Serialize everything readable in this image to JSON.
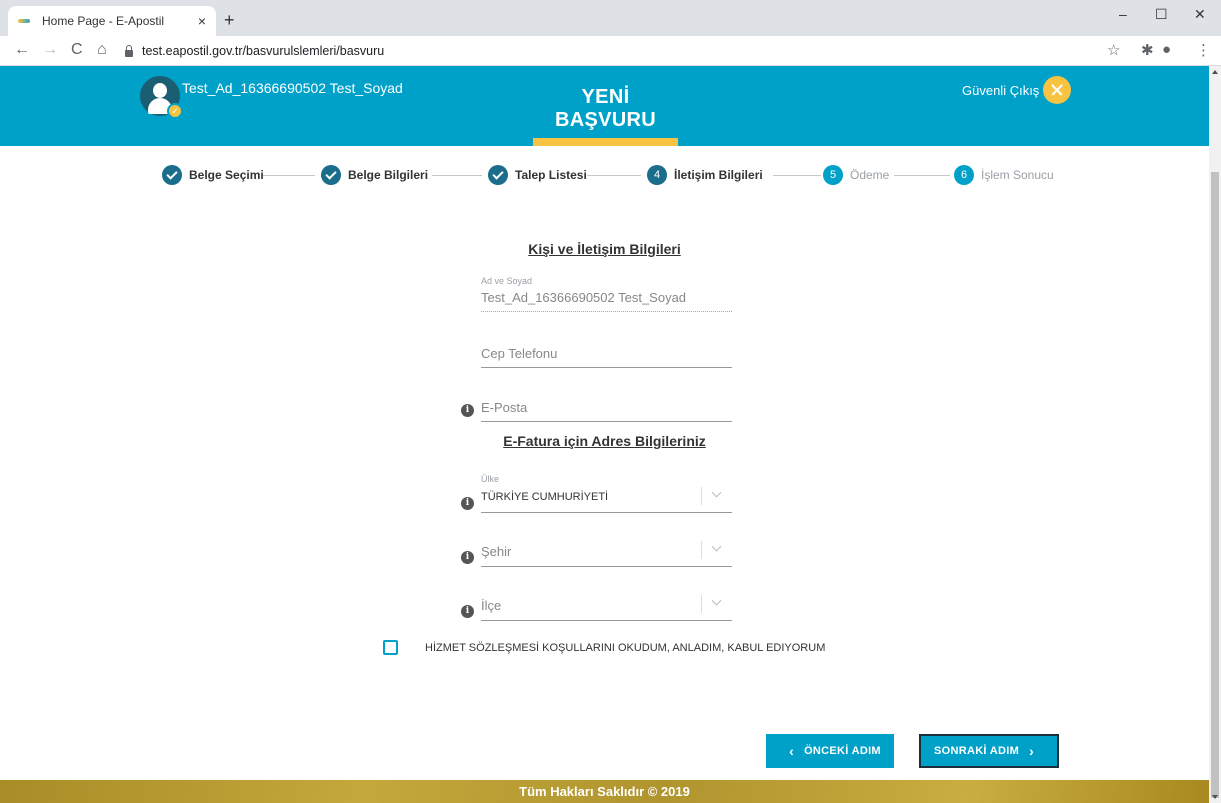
{
  "browser": {
    "tab_title": "Home Page - E-Apostil",
    "tab_close": "×",
    "new_tab": "+",
    "url": "test.eapostil.gov.tr/basvurulslemleri/basvuru",
    "window_controls": [
      "–",
      "☐",
      "✕"
    ]
  },
  "header": {
    "user_name": "Test_Ad_16366690502 Test_Soyad",
    "page_title": "YENİ BAŞVURU",
    "logout_label": "Güvenli Çıkış",
    "accent_color": "#00a1c9",
    "highlight_color": "#f6c342"
  },
  "steps": [
    {
      "number": "1",
      "label": "Belge Seçimi",
      "status": "done"
    },
    {
      "number": "2",
      "label": "Belge Bilgileri",
      "status": "done"
    },
    {
      "number": "3",
      "label": "Talep Listesi",
      "status": "done"
    },
    {
      "number": "4",
      "label": "İletişim Bilgileri",
      "status": "active"
    },
    {
      "number": "5",
      "label": "Ödeme",
      "status": "pending"
    },
    {
      "number": "6",
      "label": "İşlem Sonucu",
      "status": "pending"
    }
  ],
  "contact": {
    "section_title": "Kişi ve İletişim Bilgileri",
    "name_label": "Ad ve Soyad",
    "name_value": "Test_Ad_16366690502 Test_Soyad",
    "phone_placeholder": "Cep Telefonu",
    "email_placeholder": "E-Posta"
  },
  "address": {
    "section_title": "E-Fatura için Adres Bilgileriniz",
    "country_label": "Ülke",
    "country_value": "TÜRKİYE CUMHURİYETİ",
    "city_placeholder": "Şehir",
    "district_placeholder": "İlçe"
  },
  "agreement": {
    "label": "HİZMET SÖZLEŞMESİ KOŞULLARINI OKUDUM, ANLADIM, KABUL EDIYORUM",
    "checked": false
  },
  "buttons": {
    "prev_label": "ÖNCEKİ ADIM",
    "next_label": "SONRAKİ ADIM"
  },
  "footer": {
    "text": "Tüm Hakları Saklıdır © 2019"
  }
}
